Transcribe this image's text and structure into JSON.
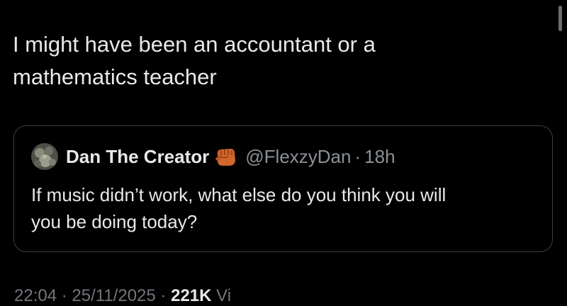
{
  "tweet": {
    "text_line1": "I might have been an accountant or a",
    "text_line2": "mathematics teacher"
  },
  "quote": {
    "display_name": "Dan The Creator",
    "emoji_icon": "oncoming-fist-emoji",
    "handle": "@FlexzyDan",
    "separator": "·",
    "time": "18h",
    "text_line1": "If music didn’t work, what else do you think you will",
    "text_line2": "you be doing today?"
  },
  "meta": {
    "time": "22:04",
    "separator": "·",
    "date": "25/11/2025",
    "views_count": "221K",
    "views_label": "Vi"
  },
  "colors": {
    "background": "#000000",
    "text_primary": "#e7e9ea",
    "text_secondary": "#8b9095",
    "border": "#3b3f43"
  }
}
